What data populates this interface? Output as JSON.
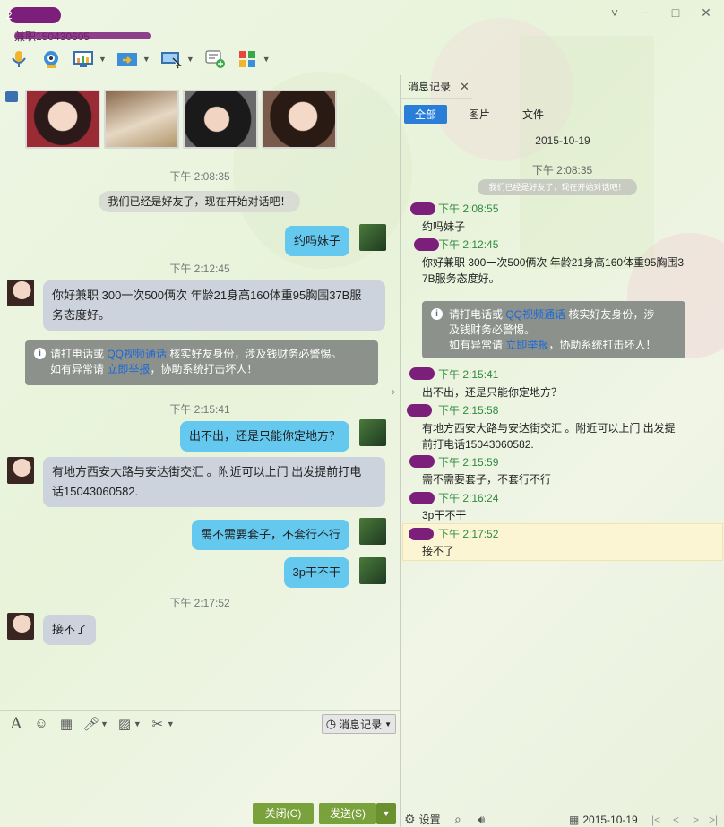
{
  "header": {
    "contact_name": "2",
    "signature": "兼职150430605",
    "window_controls": [
      "˅",
      "−",
      "□",
      "✕"
    ]
  },
  "left_chat": {
    "messages": [
      {
        "kind": "time",
        "text": "下午 2:08:35"
      },
      {
        "kind": "system",
        "text": "我们已经是好友了，现在开始对话吧！"
      },
      {
        "kind": "out",
        "text": "约吗妹子"
      },
      {
        "kind": "time",
        "text": "下午 2:12:45"
      },
      {
        "kind": "in",
        "lines": [
          "你好兼职 300一次500俩次 年龄21身高160体重95胸围37B服",
          "务态度好。"
        ]
      },
      {
        "kind": "notice",
        "line1_a": "请打电话或 ",
        "line1_link": "QQ视频通话",
        "line1_b": " 核实好友身份，涉及钱财务必警惕。",
        "line2_a": "如有异常请 ",
        "line2_link": "立即举报",
        "line2_b": "，协助系统打击坏人！"
      },
      {
        "kind": "time",
        "text": "下午 2:15:41"
      },
      {
        "kind": "out",
        "text": "出不出，还是只能你定地方？"
      },
      {
        "kind": "in",
        "lines": [
          "有地方西安大路与安达街交汇 。附近可以上门    出发提前打电",
          "话15043060582."
        ]
      },
      {
        "kind": "out",
        "text": "需不需要套子，不套行不行"
      },
      {
        "kind": "out",
        "text": "3p干不干"
      },
      {
        "kind": "time",
        "text": "下午 2:17:52"
      },
      {
        "kind": "in",
        "lines": [
          "接不了"
        ]
      }
    ]
  },
  "input_toolbar": {
    "font_label": "A",
    "history_label": "消息记录"
  },
  "buttons": {
    "close_label": "关闭(C)",
    "send_label": "发送(S)",
    "send_arrow": "▼"
  },
  "right_panel": {
    "tab_title": "消息记录",
    "tab_close": "✕",
    "filters": [
      "全部",
      "图片",
      "文件"
    ],
    "date": "2015-10-19",
    "first_time": "下午 2:08:35",
    "system_msg": "我们已经是好友了，现在开始对话吧！",
    "entries": [
      {
        "time": "下午 2:08:55",
        "lines": [
          "约吗妹子"
        ]
      },
      {
        "time": "下午 2:12:45",
        "lines": [
          "你好兼职 300一次500俩次 年龄21身高160体重95胸围3",
          "7B服务态度好。"
        ]
      },
      {
        "time": "下午 2:15:41",
        "lines": [
          "出不出，还是只能你定地方？"
        ]
      },
      {
        "time": "下午 2:15:58",
        "lines": [
          "有地方西安大路与安达街交汇 。附近可以上门    出发提",
          "前打电话15043060582."
        ]
      },
      {
        "time": "下午 2:15:59",
        "lines": [
          "需不需要套子，不套行不行"
        ]
      },
      {
        "time": "下午 2:16:24",
        "lines": [
          "3p干不干"
        ]
      },
      {
        "time": "下午 2:17:52",
        "lines": [
          "接不了"
        ]
      }
    ],
    "notice": {
      "line1_a": "请打电话或 ",
      "line1_link": "QQ视频通话",
      "line1_b": " 核实好友身份，涉",
      "line2": "及钱财务必警惕。",
      "line3_a": "如有异常请 ",
      "line3_link": "立即举报",
      "line3_b": "，协助系统打击坏人！"
    },
    "bottom": {
      "settings_label": "设置",
      "date": "2015-10-19",
      "nav": [
        "|<",
        "<",
        ">",
        ">|"
      ]
    }
  },
  "colors": {
    "bubble_out": "#64c8ef",
    "bubble_in": "#ccd3dc",
    "accent": "#2b7ed7",
    "send_button": "#7aa23c",
    "time_green": "#2e8a3e"
  }
}
